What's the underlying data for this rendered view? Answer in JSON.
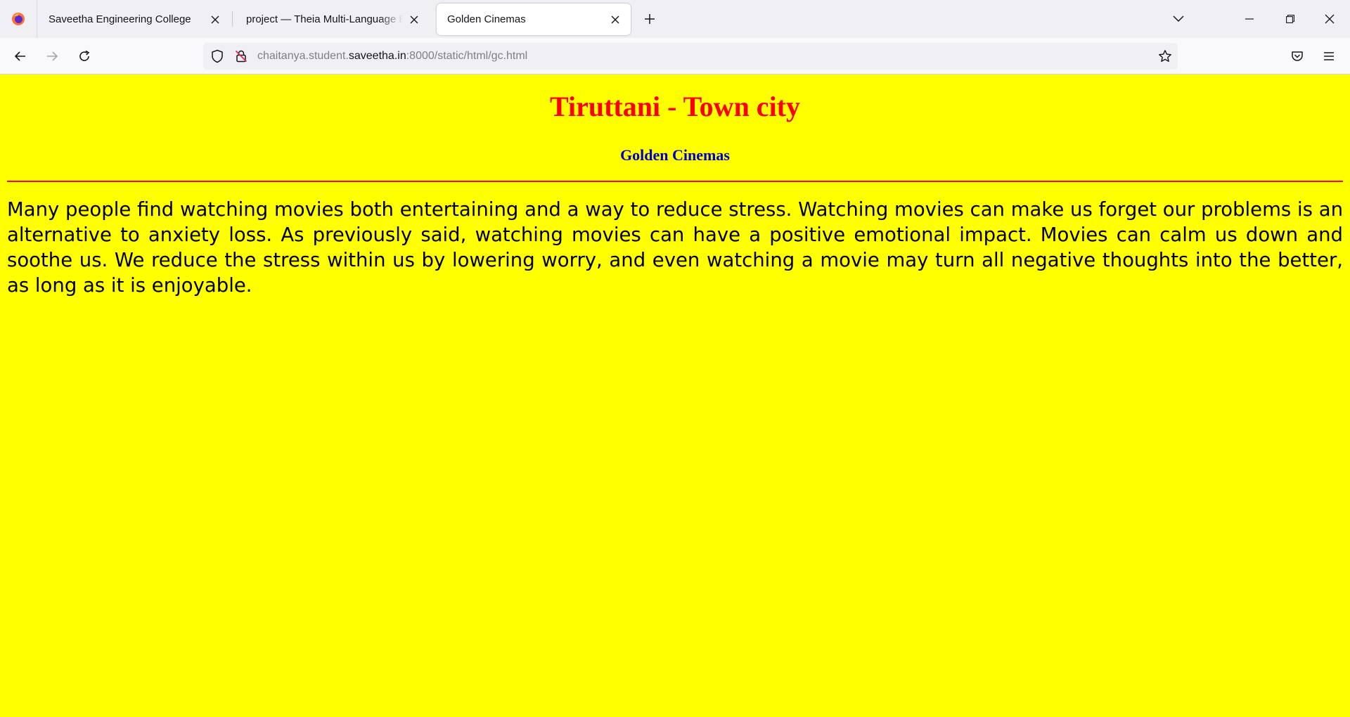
{
  "browser": {
    "tabs": [
      {
        "title": "Saveetha Engineering College",
        "active": false
      },
      {
        "title": "project — Theia Multi-Language Ex",
        "active": false
      },
      {
        "title": "Golden Cinemas",
        "active": true
      }
    ],
    "url": {
      "prefix": "chaitanya.student.",
      "host": "saveetha.in",
      "suffix": ":8000/static/html/gc.html"
    },
    "icons": {
      "back": "arrow-left-icon",
      "forward": "arrow-right-icon",
      "reload": "reload-icon",
      "shield": "tracking-shield-icon",
      "lock": "insecure-lock-icon",
      "star": "bookmark-star-icon",
      "pocket": "pocket-icon",
      "menu": "hamburger-menu-icon"
    }
  },
  "page": {
    "background": "#ffff00",
    "heading": "Tiruttani - Town city",
    "heading_color": "#ff0000",
    "subheading": "Golden Cinemas",
    "subheading_color": "#0000cc",
    "rule_color": "#ff0000",
    "paragraph": "Many people find watching movies both entertaining and a way to reduce stress. Watching movies can make us forget our problems is an alternative to anxiety loss. As previously said, watching movies can have a positive emotional impact. Movies can calm us down and soothe us. We reduce the stress within us by lowering worry, and even watching a movie may turn all negative thoughts into the better, as long as it is enjoyable."
  }
}
